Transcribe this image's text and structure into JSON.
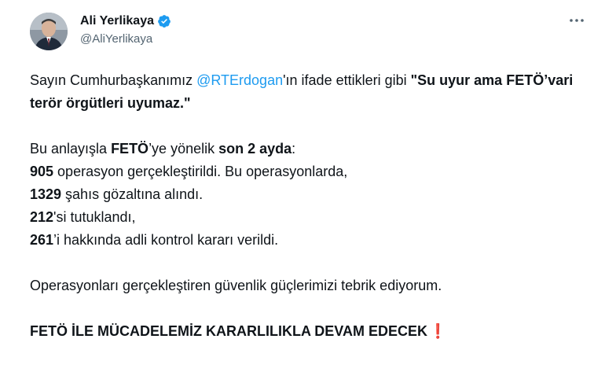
{
  "author": {
    "name": "Ali Yerlikaya",
    "handle": "@AliYerlikaya",
    "verified_icon": "verified-badge-icon",
    "more_icon": "more-options-icon",
    "accent": "#1d9bf0"
  },
  "tweet": {
    "p1": {
      "t1": "Sayın Cumhurbaşkanımız ",
      "mention": "@RTErdogan",
      "t2": "'ın ifade ettikleri gibi ",
      "bold": "\"Su uyur ama FETÖ’vari terör örgütleri uyumaz.\""
    },
    "p2": {
      "l1_t1": "Bu anlayışla ",
      "l1_b1": "FETÖ",
      "l1_t2": "’ye yönelik ",
      "l1_b2": "son 2 ayda",
      "l1_t3": ":",
      "l2_b": "905",
      "l2_t": " operasyon gerçekleştirildi. Bu operasyonlarda,",
      "l3_b": "1329",
      "l3_t": " şahıs gözaltına alındı.",
      "l4_b": "212",
      "l4_t": "'si tutuklandı,",
      "l5_b": "261",
      "l5_t": "’i hakkında adli kontrol kararı verildi."
    },
    "p3": "Operasyonları gerçekleştiren güvenlik güçlerimizi tebrik ediyorum.",
    "p4": "FETÖ İLE MÜCADELEMİZ KARARLILIKLA DEVAM EDECEK",
    "p4_emoji": "❗"
  }
}
